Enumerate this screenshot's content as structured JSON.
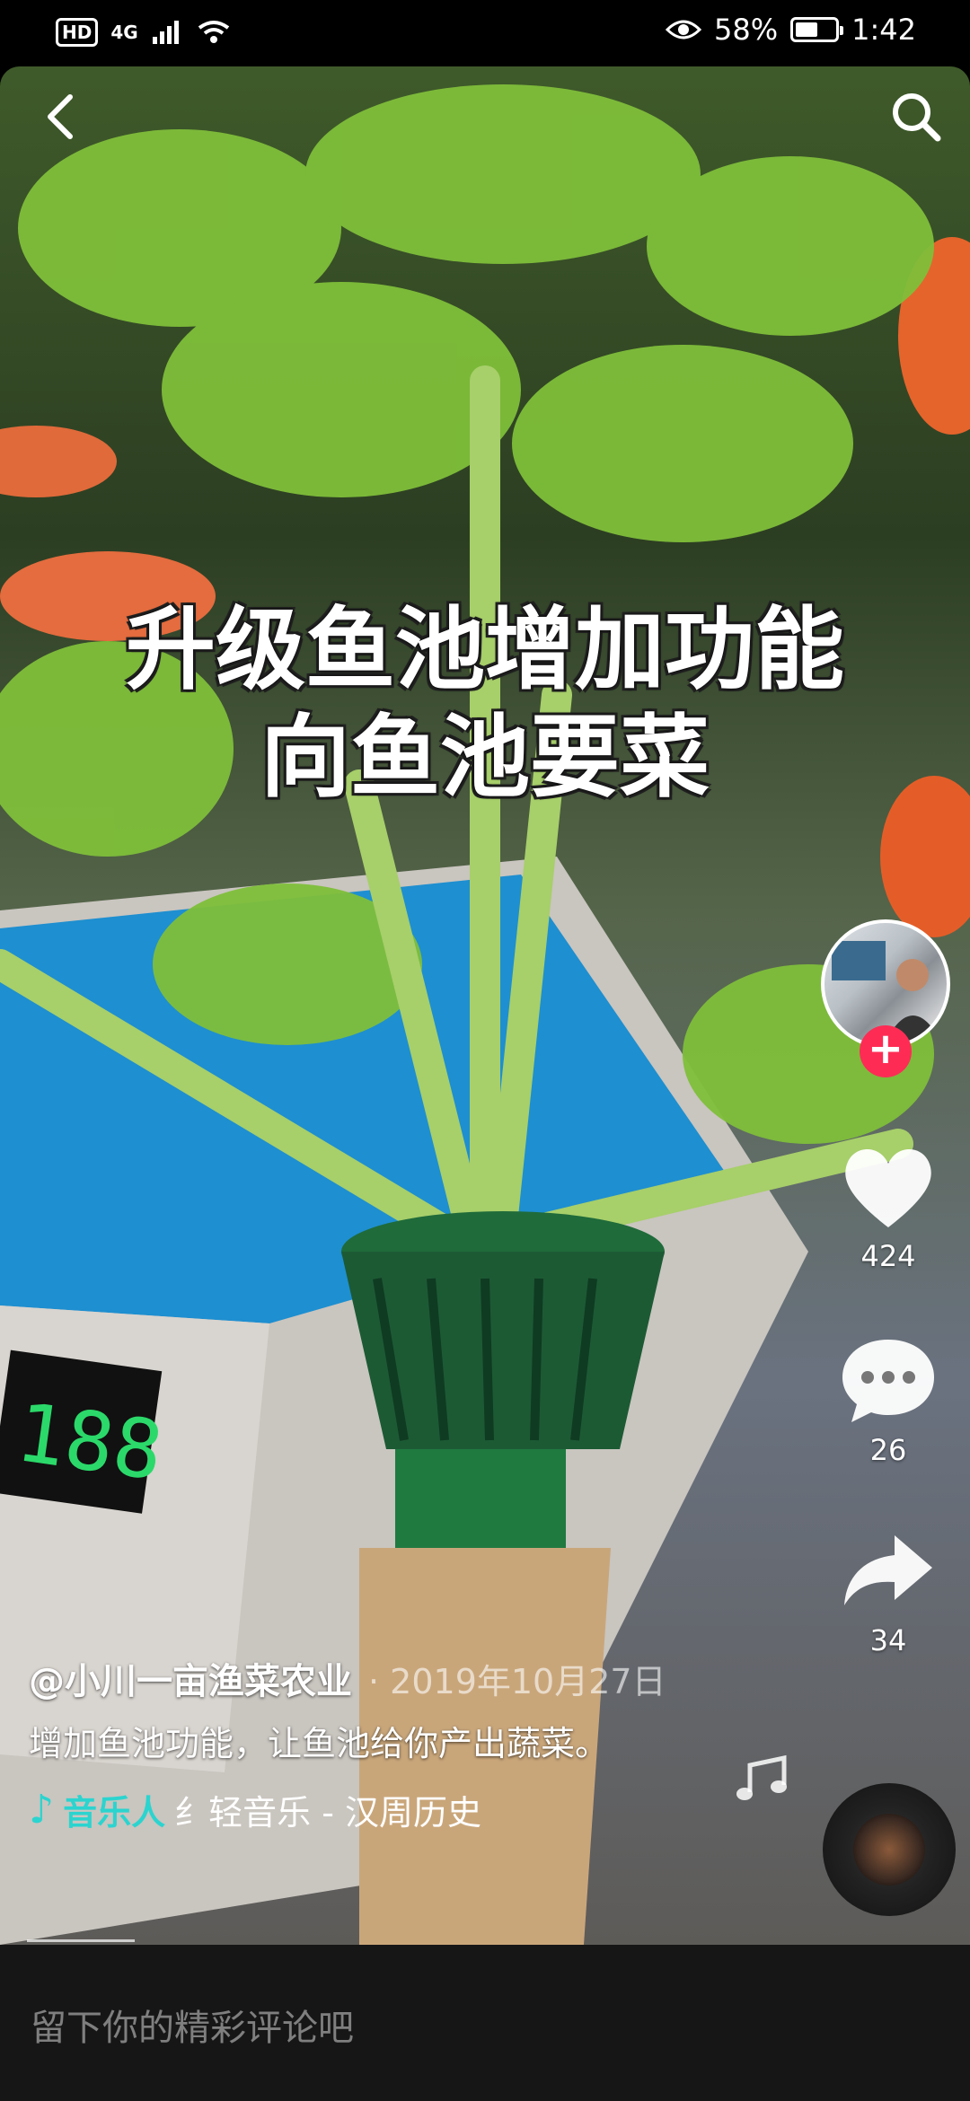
{
  "status_bar": {
    "hd": "HD",
    "network": "4G",
    "battery_percent": "58%",
    "battery_level": 0.58,
    "time": "1:42",
    "icons": [
      "signal-icon",
      "wifi-icon",
      "eye-icon",
      "battery-icon"
    ]
  },
  "video": {
    "caption_line1": "升级鱼池增加功能",
    "caption_line2": "向鱼池要菜"
  },
  "actions": {
    "like_count": "424",
    "comment_count": "26",
    "share_count": "34",
    "follow_symbol": "+"
  },
  "post": {
    "author": "@小川一亩渔菜农业",
    "date": "· 2019年10月27日",
    "description": "增加鱼池功能，让鱼池给你产出蔬菜。",
    "music_icon": "♪",
    "musician": "音乐人",
    "track": "纟轻音乐 - 汉周历史"
  },
  "comment_bar": {
    "placeholder": "留下你的精彩评论吧"
  },
  "colors": {
    "accent_red": "#fe2c55",
    "music_teal": "#2bd4cf"
  }
}
